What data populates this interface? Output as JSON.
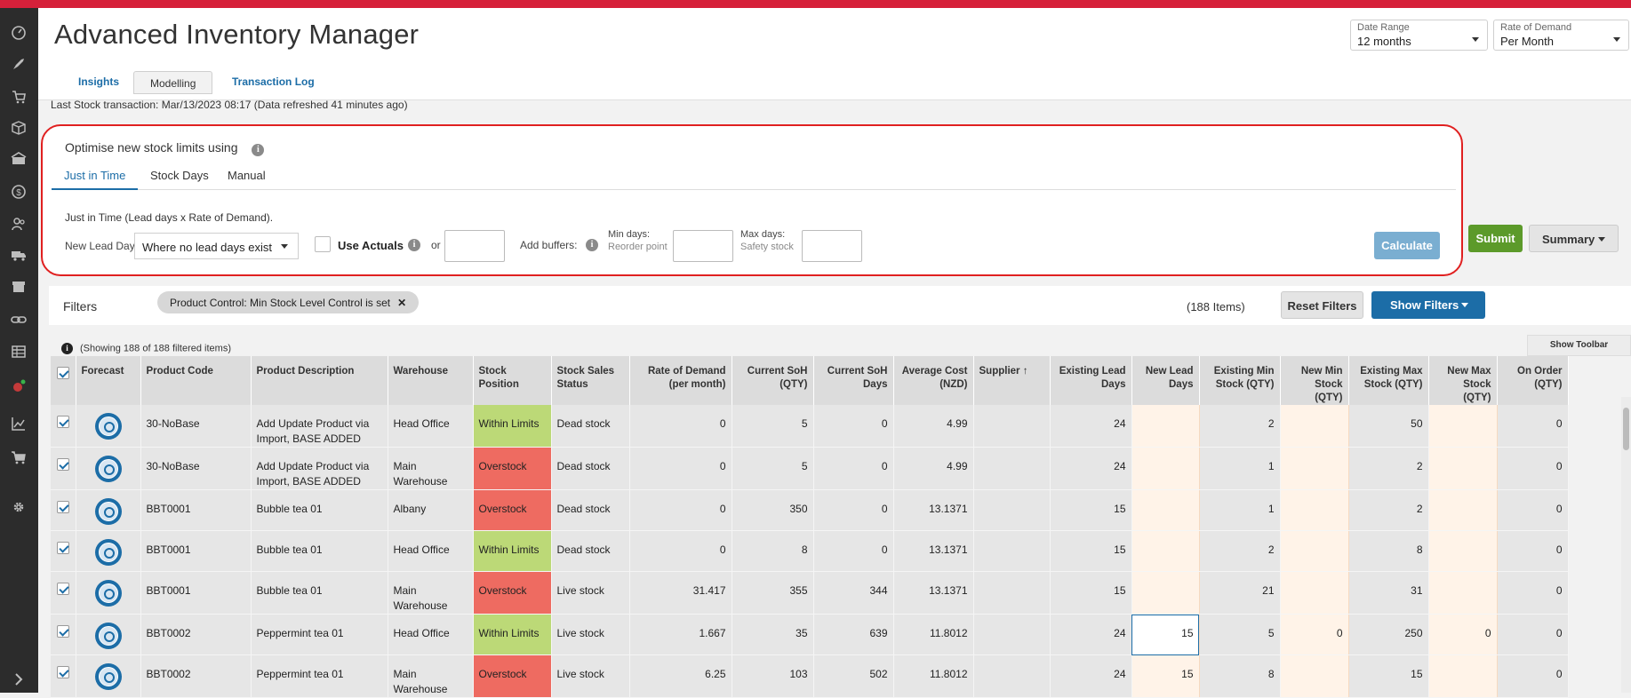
{
  "app": {
    "title": "Advanced Inventory Manager"
  },
  "header": {
    "date_range": {
      "label": "Date Range",
      "value": "12 months"
    },
    "rate_of_demand": {
      "label": "Rate of Demand",
      "value": "Per Month"
    }
  },
  "tabs": [
    {
      "label": "Insights"
    },
    {
      "label": "Modelling"
    },
    {
      "label": "Transaction Log"
    }
  ],
  "last_stock": "Last Stock transaction: Mar/13/2023 08:17 (Data refreshed 41 minutes ago)",
  "optimise": {
    "title": "Optimise new stock limits using",
    "tabs": [
      {
        "label": "Just in Time"
      },
      {
        "label": "Stock Days"
      },
      {
        "label": "Manual"
      }
    ],
    "description": "Just in Time (Lead days x Rate of Demand).",
    "new_lead_days_label": "New Lead Days:",
    "lead_days_select": "Where no lead days exist",
    "use_actuals": "Use Actuals",
    "or": "or",
    "add_buffers": "Add buffers:",
    "min_days": "Min days:",
    "reorder_point": "Reorder point",
    "max_days": "Max days:",
    "safety_stock": "Safety stock",
    "calculate": "Calculate"
  },
  "actions": {
    "submit": "Submit",
    "summary": "Summary"
  },
  "filters": {
    "label": "Filters",
    "pill": "Product Control: Min Stock Level Control is set",
    "pill_close": "✕",
    "count": "(188 Items)",
    "reset": "Reset Filters",
    "show": "Show Filters"
  },
  "showing": "(Showing 188 of 188 filtered items)",
  "show_toolbar": "Show Toolbar",
  "table": {
    "headers": [
      "Forecast",
      "Product Code",
      "Product Description",
      "Warehouse",
      "Stock Position",
      "Stock Sales Status",
      "Rate of Demand (per month)",
      "Current SoH (QTY)",
      "Current SoH Days",
      "Average Cost (NZD)",
      "Supplier",
      "Existing Lead Days",
      "New Lead Days",
      "Existing Min Stock (QTY)",
      "New Min Stock (QTY)",
      "Existing Max Stock (QTY)",
      "New Max Stock (QTY)",
      "On Order (QTY)"
    ],
    "sort_indicator": "↑",
    "rows": [
      {
        "code": "30-NoBase",
        "desc": "Add Update Product via Import, BASE ADDED",
        "wh": "Head Office",
        "pos": "Within Limits",
        "status": "Dead stock",
        "rod": "0",
        "soh": "5",
        "sohd": "0",
        "cost": "4.99",
        "sup": "",
        "eld": "24",
        "nld": "",
        "emin": "2",
        "nmin": "",
        "emax": "50",
        "nmax": "",
        "oo": "0"
      },
      {
        "code": "30-NoBase",
        "desc": "Add Update Product via Import, BASE ADDED",
        "wh": "Main Warehouse",
        "pos": "Overstock",
        "status": "Dead stock",
        "rod": "0",
        "soh": "5",
        "sohd": "0",
        "cost": "4.99",
        "sup": "",
        "eld": "24",
        "nld": "",
        "emin": "1",
        "nmin": "",
        "emax": "2",
        "nmax": "",
        "oo": "0"
      },
      {
        "code": "BBT0001",
        "desc": "Bubble tea 01",
        "wh": "Albany",
        "pos": "Overstock",
        "status": "Dead stock",
        "rod": "0",
        "soh": "350",
        "sohd": "0",
        "cost": "13.1371",
        "sup": "",
        "eld": "15",
        "nld": "",
        "emin": "1",
        "nmin": "",
        "emax": "2",
        "nmax": "",
        "oo": "0"
      },
      {
        "code": "BBT0001",
        "desc": "Bubble tea 01",
        "wh": "Head Office",
        "pos": "Within Limits",
        "status": "Dead stock",
        "rod": "0",
        "soh": "8",
        "sohd": "0",
        "cost": "13.1371",
        "sup": "",
        "eld": "15",
        "nld": "",
        "emin": "2",
        "nmin": "",
        "emax": "8",
        "nmax": "",
        "oo": "0"
      },
      {
        "code": "BBT0001",
        "desc": "Bubble tea 01",
        "wh": "Main Warehouse",
        "pos": "Overstock",
        "status": "Live stock",
        "rod": "31.417",
        "soh": "355",
        "sohd": "344",
        "cost": "13.1371",
        "sup": "",
        "eld": "15",
        "nld": "",
        "emin": "21",
        "nmin": "",
        "emax": "31",
        "nmax": "",
        "oo": "0"
      },
      {
        "code": "BBT0002",
        "desc": "Peppermint tea 01",
        "wh": "Head Office",
        "pos": "Within Limits",
        "status": "Live stock",
        "rod": "1.667",
        "soh": "35",
        "sohd": "639",
        "cost": "11.8012",
        "sup": "",
        "eld": "24",
        "nld": "15",
        "emin": "5",
        "nmin": "0",
        "emax": "250",
        "nmax": "0",
        "oo": "0"
      },
      {
        "code": "BBT0002",
        "desc": "Peppermint tea 01",
        "wh": "Main Warehouse",
        "pos": "Overstock",
        "status": "Live stock",
        "rod": "6.25",
        "soh": "103",
        "sohd": "502",
        "cost": "11.8012",
        "sup": "",
        "eld": "24",
        "nld": "15",
        "emin": "8",
        "nmin": "",
        "emax": "15",
        "nmax": "",
        "oo": "0"
      }
    ]
  },
  "sidebar": {
    "icons": [
      "gauge-icon",
      "rocket-icon",
      "cart-arrow-icon",
      "box-icon",
      "warehouse-icon",
      "dollar-icon",
      "people-icon",
      "truck-icon",
      "store-icon",
      "link-icon",
      "table-icon",
      "pin-icon",
      "chart-icon",
      "cart-icon",
      "gear-icon",
      "expand-icon"
    ]
  }
}
